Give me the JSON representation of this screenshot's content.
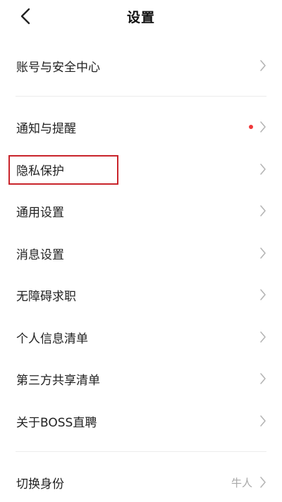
{
  "header": {
    "title": "设置",
    "back_icon": "chevron-left-icon"
  },
  "sections": [
    {
      "items": [
        {
          "label": "账号与安全中心"
        }
      ]
    },
    {
      "items": [
        {
          "label": "通知与提醒",
          "badge_dot": true
        },
        {
          "label": "隐私保护",
          "highlighted": true
        },
        {
          "label": "通用设置"
        },
        {
          "label": "消息设置"
        },
        {
          "label": "无障碍求职"
        },
        {
          "label": "个人信息清单"
        },
        {
          "label": "第三方共享清单"
        },
        {
          "label": "关于BOSS直聘"
        }
      ]
    },
    {
      "items": [
        {
          "label": "切换身份",
          "value": "牛人"
        }
      ]
    }
  ],
  "colors": {
    "badge": "#f0383a",
    "highlight": "#c9242b",
    "chevron": "#b3b3b3",
    "divider": "#ececec"
  }
}
